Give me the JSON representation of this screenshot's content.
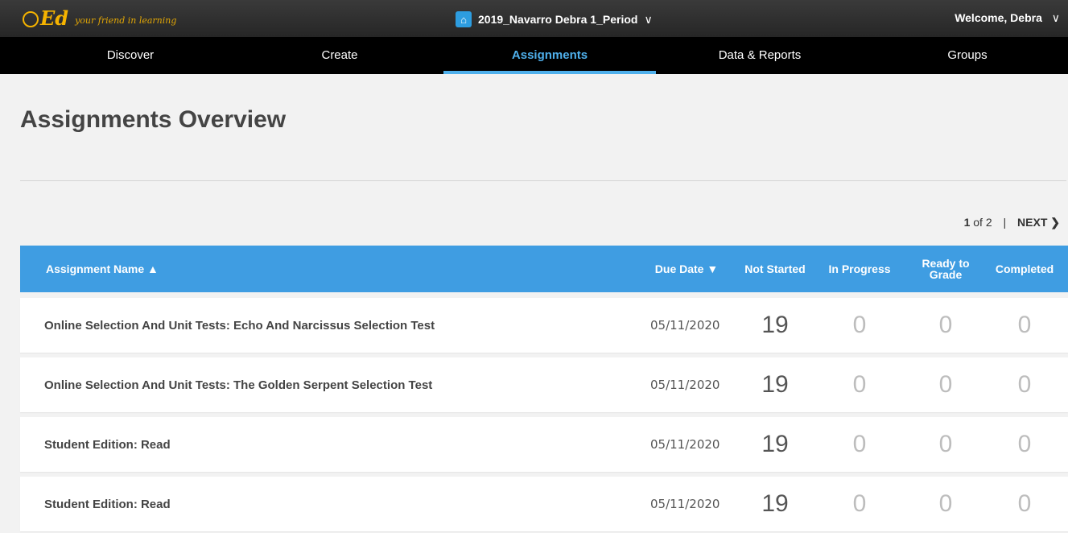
{
  "header": {
    "logo_text": "Ed",
    "tagline": "your friend in learning",
    "class_name": "2019_Navarro Debra 1_Period",
    "welcome": "Welcome, Debra"
  },
  "nav": {
    "items": [
      {
        "label": "Discover"
      },
      {
        "label": "Create"
      },
      {
        "label": "Assignments"
      },
      {
        "label": "Data & Reports"
      },
      {
        "label": "Groups"
      }
    ],
    "active_index": 2
  },
  "page": {
    "title": "Assignments Overview"
  },
  "pager": {
    "current": "1",
    "of_text": "of 2",
    "next": "NEXT"
  },
  "table": {
    "headers": {
      "name": "Assignment Name ▲",
      "due": "Due Date ▼",
      "not_started": "Not Started",
      "in_progress": "In Progress",
      "ready_line1": "Ready to",
      "ready_line2": "Grade",
      "completed": "Completed"
    },
    "rows": [
      {
        "name": "Online Selection And Unit Tests: Echo And Narcissus Selection Test",
        "due": "05/11/2020",
        "not_started": "19",
        "in_progress": "0",
        "ready": "0",
        "completed": "0"
      },
      {
        "name": "Online Selection And Unit Tests: The Golden Serpent Selection Test",
        "due": "05/11/2020",
        "not_started": "19",
        "in_progress": "0",
        "ready": "0",
        "completed": "0"
      },
      {
        "name": "Student Edition: Read",
        "due": "05/11/2020",
        "not_started": "19",
        "in_progress": "0",
        "ready": "0",
        "completed": "0"
      },
      {
        "name": "Student Edition: Read",
        "due": "05/11/2020",
        "not_started": "19",
        "in_progress": "0",
        "ready": "0",
        "completed": "0"
      }
    ]
  },
  "colors": {
    "accent": "#3f9de2",
    "nav_active": "#4fb0ec",
    "logo": "#f5b300"
  }
}
